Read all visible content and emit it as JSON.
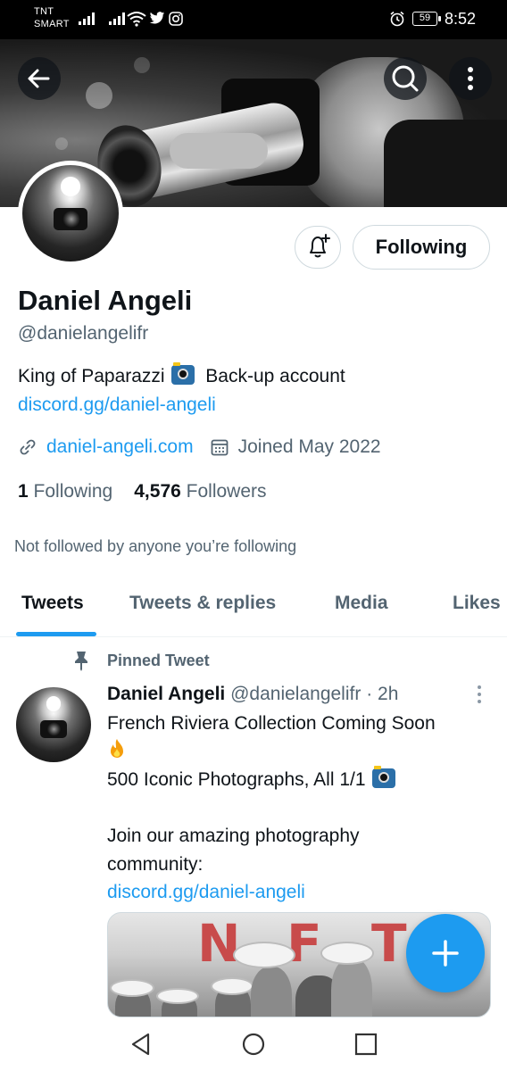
{
  "status_bar": {
    "carrier_line1": "TNT",
    "carrier_line2": "SMART",
    "battery": "59",
    "time": "8:52"
  },
  "profile": {
    "name": "Daniel Angeli",
    "handle": "@danielangelifr",
    "bio_text": "King of Paparazzi",
    "bio_suffix": "Back-up account",
    "bio_link": "discord.gg/daniel-angeli",
    "website": "daniel-angeli.com",
    "joined": "Joined May 2022",
    "following_count": "1",
    "following_label": "Following",
    "followers_count": "4,576",
    "followers_label": "Followers",
    "not_followed": "Not followed by anyone you’re following",
    "following_button": "Following"
  },
  "tabs": [
    {
      "label": "Tweets",
      "active": true
    },
    {
      "label": "Tweets & replies",
      "active": false
    },
    {
      "label": "Media",
      "active": false
    },
    {
      "label": "Likes",
      "active": false
    }
  ],
  "pinned_tweet": {
    "pinned_label": "Pinned Tweet",
    "author": "Daniel Angeli",
    "handle": "@danielangelifr",
    "time": "· 2h",
    "line1": "French Riviera Collection Coming Soon",
    "line3": "500 Iconic Photographs, All 1/1",
    "line5": "Join our amazing photography",
    "line6": "community:",
    "link": "discord.gg/daniel-angeli",
    "media_letters": [
      "N",
      "F",
      "T"
    ]
  },
  "colors": {
    "accent": "#1d9bf0",
    "text": "#0f1419",
    "secondary": "#536471"
  },
  "icons": {
    "back": "arrow-left-icon",
    "search": "search-icon",
    "more": "more-vertical-icon",
    "notify": "bell-plus-icon",
    "link": "link-icon",
    "calendar": "calendar-icon",
    "pin": "pin-icon",
    "compose": "plus-icon"
  }
}
